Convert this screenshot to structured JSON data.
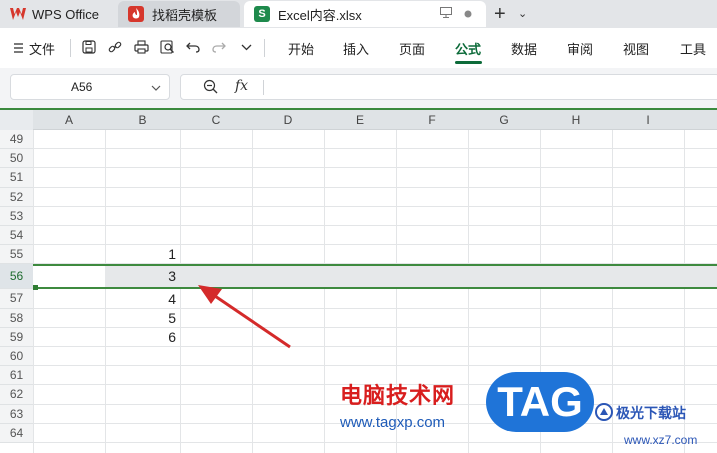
{
  "tabs": {
    "wps_label": "WPS Office",
    "template_label": "找稻壳模板",
    "file_label": "Excel内容.xlsx",
    "file_logo": "S"
  },
  "menu": {
    "file_label": "文件",
    "ribbon_tabs": [
      "开始",
      "插入",
      "页面",
      "公式",
      "数据",
      "审阅",
      "视图",
      "工具"
    ],
    "active_tab": "公式"
  },
  "formula_bar": {
    "name_box": "A56",
    "fx_label": "fx",
    "formula": ""
  },
  "grid": {
    "columns": [
      "A",
      "B",
      "C",
      "D",
      "E",
      "F",
      "G",
      "H",
      "I"
    ],
    "rows": [
      "49",
      "50",
      "51",
      "52",
      "53",
      "54",
      "55",
      "56",
      "57",
      "58",
      "59",
      "60",
      "61",
      "62",
      "63",
      "64"
    ],
    "selected_row": "56",
    "cells": [
      {
        "ref": "B55",
        "value": "1"
      },
      {
        "ref": "B56",
        "value": "3"
      },
      {
        "ref": "B57",
        "value": "4"
      },
      {
        "ref": "B58",
        "value": "5"
      },
      {
        "ref": "B59",
        "value": "6"
      }
    ]
  },
  "watermark": {
    "cn_text": "电脑技术网",
    "url": "www.tagxp.com",
    "badge": "TAG",
    "site_cn": "极光下载站",
    "site_url": "www.xz7.com"
  },
  "colors": {
    "accent_green": "#0d6b3a",
    "selection_border": "#3e8a3f",
    "arrow_red": "#d42a2a"
  }
}
